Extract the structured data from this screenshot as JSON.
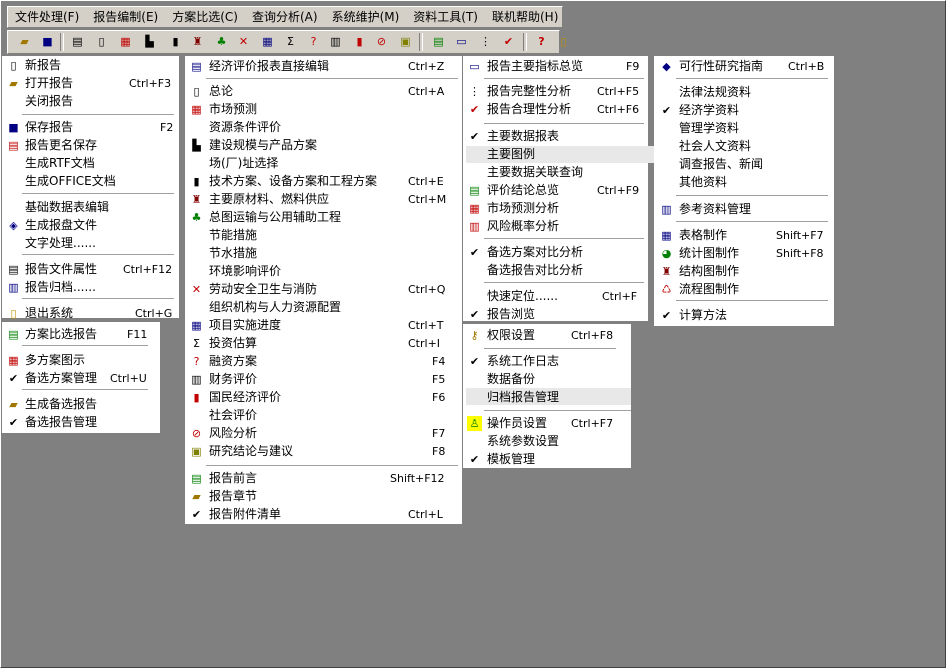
{
  "menubar": [
    "文件处理(F)",
    "报告编制(E)",
    "方案比选(C)",
    "查询分析(A)",
    "系统维护(M)",
    "资料工具(T)",
    "联机帮助(H)"
  ],
  "col1": {
    "new_report": "新报告",
    "open_report": "打开报告",
    "open_report_sc": "Ctrl+F3",
    "close_report": "关闭报告",
    "save_report": "保存报告",
    "save_report_sc": "F2",
    "save_as": "报告更名保存",
    "gen_rtf": "生成RTF文档",
    "gen_office": "生成OFFICE文档",
    "basic_data_edit": "基础数据表编辑",
    "gen_report_file": "生成报盘文件",
    "text_process": "文字处理......",
    "report_props": "报告文件属性",
    "report_props_sc": "Ctrl+F12",
    "report_archive": "报告归档......",
    "exit": "退出系统",
    "exit_sc": "Ctrl+G",
    "plan_compare_report": "方案比选报告",
    "plan_compare_report_sc": "F11",
    "multi_plan_chart": "多方案图示",
    "alt_plan_manage": "备选方案管理",
    "alt_plan_manage_sc": "Ctrl+U",
    "gen_alt_report": "生成备选报告",
    "alt_report_manage": "备选报告管理"
  },
  "col2": {
    "direct_edit": "经济评价报表直接编辑",
    "direct_edit_sc": "Ctrl+Z",
    "overview": "总论",
    "overview_sc": "Ctrl+A",
    "market_forecast": "市场预测",
    "resource_eval": "资源条件评价",
    "scale_plan": "建设规模与产品方案",
    "site_selection": "场(厂)址选择",
    "tech_plan": "技术方案、设备方案和工程方案",
    "tech_plan_sc": "Ctrl+E",
    "materials": "主要原材料、燃料供应",
    "materials_sc": "Ctrl+M",
    "layout": "总图运输与公用辅助工程",
    "energy_saving": "节能措施",
    "water_saving": "节水措施",
    "env_impact": "环境影响评价",
    "safety": "劳动安全卫生与消防",
    "safety_sc": "Ctrl+Q",
    "organization": "组织机构与人力资源配置",
    "schedule": "项目实施进度",
    "schedule_sc": "Ctrl+T",
    "investment": "投资估算",
    "investment_sc": "Ctrl+I",
    "financing": "融资方案",
    "financing_sc": "F4",
    "financial_eval": "财务评价",
    "financial_eval_sc": "F5",
    "national_eval": "国民经济评价",
    "national_eval_sc": "F6",
    "social_eval": "社会评价",
    "risk_analysis": "风险分析",
    "risk_analysis_sc": "F7",
    "conclusion": "研究结论与建议",
    "conclusion_sc": "F8",
    "preface": "报告前言",
    "preface_sc": "Shift+F12",
    "chapters": "报告章节",
    "attachments": "报告附件清单",
    "attachments_sc": "Ctrl+L"
  },
  "col3": {
    "key_indicators": "报告主要指标总览",
    "key_indicators_sc": "F9",
    "completeness": "报告完整性分析",
    "completeness_sc": "Ctrl+F5",
    "rationality": "报告合理性分析",
    "rationality_sc": "Ctrl+F6",
    "main_tables": "主要数据报表",
    "main_charts": "主要图例",
    "linked_query": "主要数据关联查询",
    "eval_summary": "评价结论总览",
    "eval_summary_sc": "Ctrl+F9",
    "market_analysis": "市场预测分析",
    "risk_prob": "风险概率分析",
    "alt_plan_compare": "备选方案对比分析",
    "alt_report_compare": "备选报告对比分析",
    "quick_locate": "快速定位......",
    "quick_locate_sc": "Ctrl+F",
    "report_browse": "报告浏览",
    "permissions": "权限设置",
    "permissions_sc": "Ctrl+F8",
    "work_log": "系统工作日志",
    "data_backup": "数据备份",
    "archive_manage": "归档报告管理",
    "operator_setup": "操作员设置",
    "operator_setup_sc": "Ctrl+F7",
    "sys_params": "系统参数设置",
    "template_manage": "模板管理"
  },
  "col4": {
    "feasibility_guide": "可行性研究指南",
    "feasibility_guide_sc": "Ctrl+B",
    "law_data": "法律法规资料",
    "economics": "经济学资料",
    "management": "管理学资料",
    "social_humanities": "社会人文资料",
    "research_news": "调查报告、新闻",
    "other_data": "其他资料",
    "ref_manage": "参考资料管理",
    "table_make": "表格制作",
    "table_make_sc": "Shift+F7",
    "stat_chart": "统计图制作",
    "stat_chart_sc": "Shift+F8",
    "structure_chart": "结构图制作",
    "flow_chart": "流程图制作",
    "calc_method": "计算方法"
  }
}
